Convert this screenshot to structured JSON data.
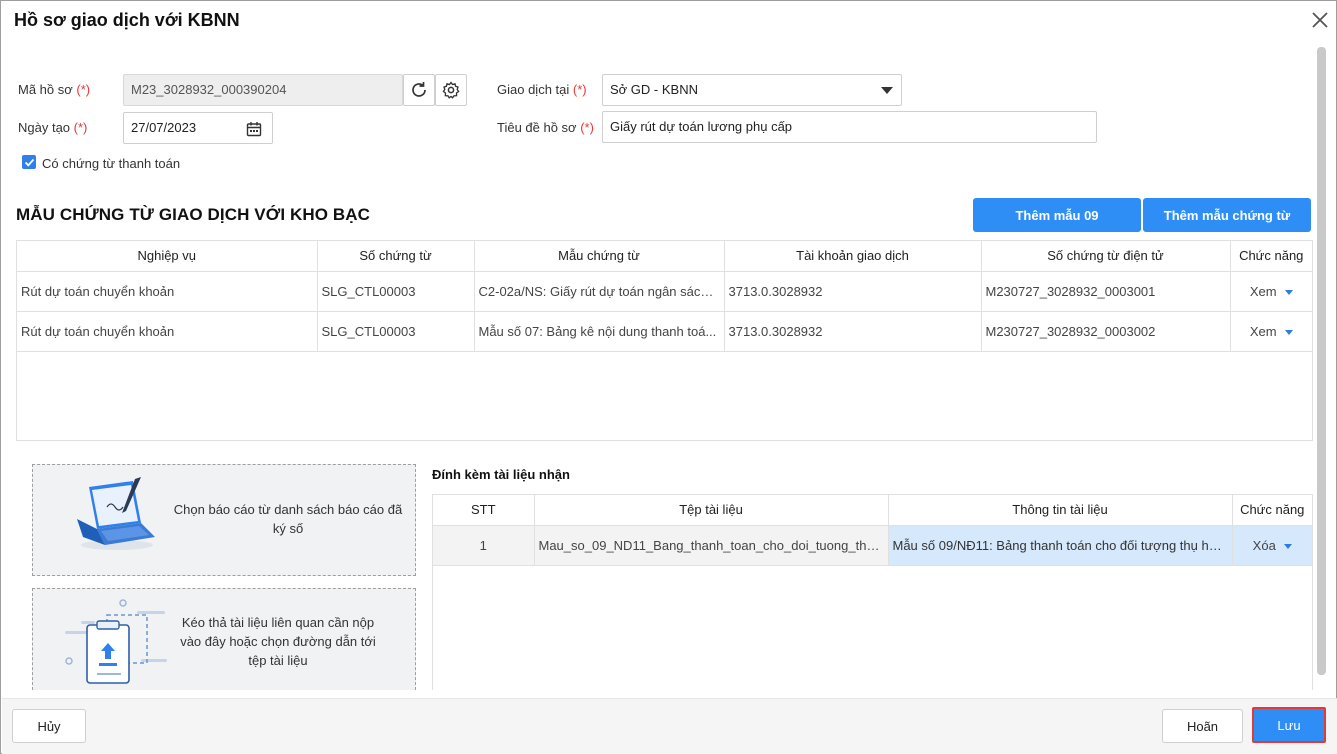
{
  "dialog": {
    "title": "Hồ sơ giao dịch với KBNN"
  },
  "form": {
    "ma_ho_so_label": "Mã hồ sơ",
    "ma_ho_so_value": "M23_3028932_000390204",
    "ngay_tao_label": "Ngày tạo",
    "ngay_tao_value": "27/07/2023",
    "giao_dich_tai_label": "Giao dịch tại",
    "giao_dich_tai_value": "Sở GD - KBNN",
    "tieu_de_label": "Tiêu đề hồ sơ",
    "tieu_de_value": "Giấy rút dự toán lương phụ cấp",
    "required_mark": "(*)",
    "co_chung_tu_label": "Có chứng từ thanh toán",
    "co_chung_tu_checked": true
  },
  "section": {
    "title": "MẪU CHỨNG TỪ GIAO DỊCH VỚI KHO BẠC",
    "btn_them_mau_09": "Thêm mẫu 09",
    "btn_them_mau_chung_tu": "Thêm mẫu chứng từ"
  },
  "voucher_table": {
    "headers": [
      "Nghiệp vụ",
      "Số chứng từ",
      "Mẫu chứng từ",
      "Tài khoản giao dịch",
      "Số chứng từ điện tử",
      "Chức năng"
    ],
    "rows": [
      [
        "Rút dự toán chuyển khoản",
        "SLG_CTL00003",
        "C2-02a/NS: Giấy rút dự toán ngân sách ...",
        "3713.0.3028932",
        "M230727_3028932_0003001",
        "Xem"
      ],
      [
        "Rút dự toán chuyển khoản",
        "SLG_CTL00003",
        "Mẫu số 07: Bảng kê nội dung thanh toá...",
        "3713.0.3028932",
        "M230727_3028932_0003002",
        "Xem"
      ]
    ]
  },
  "upload": {
    "choose_report_text": "Chọn báo cáo từ danh sách báo cáo đã ký số",
    "drag_drop_text": "Kéo thả tài liệu liên quan cần nộp vào đây hoặc chọn đường dẫn tới tệp tài liệu"
  },
  "attachments": {
    "title": "Đính kèm tài liệu nhận",
    "headers": [
      "STT",
      "Tệp tài liệu",
      "Thông tin tài liệu",
      "Chức năng"
    ],
    "rows": [
      [
        "1",
        "Mau_so_09_ND11_Bang_thanh_toan_cho_doi_tuong_thu_...",
        "Mẫu số 09/NĐ11: Bảng thanh toán cho đối tượng thụ hư...",
        "Xóa"
      ]
    ]
  },
  "footer": {
    "cancel": "Hủy",
    "postpone": "Hoãn",
    "save": "Lưu"
  },
  "colors": {
    "primary": "#2f8ef5",
    "link": "#2a7de1",
    "required": "#e53935",
    "highlight": "#d6e8fb"
  }
}
